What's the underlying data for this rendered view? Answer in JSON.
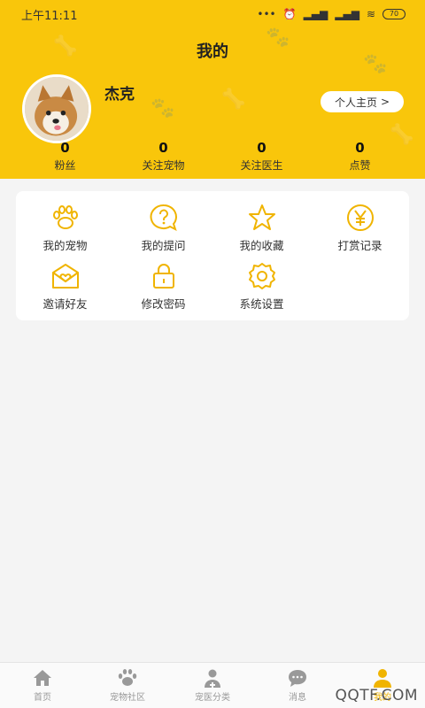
{
  "status": {
    "time": "上午11:11",
    "battery": "70"
  },
  "header": {
    "title": "我的"
  },
  "profile": {
    "name": "杰克",
    "homepage_label": "个人主页"
  },
  "stats": [
    {
      "value": "0",
      "label": "粉丝"
    },
    {
      "value": "0",
      "label": "关注宠物"
    },
    {
      "value": "0",
      "label": "关注医生"
    },
    {
      "value": "0",
      "label": "点赞"
    }
  ],
  "menu": [
    {
      "label": "我的宠物",
      "icon": "paw-icon"
    },
    {
      "label": "我的提问",
      "icon": "question-bubble-icon"
    },
    {
      "label": "我的收藏",
      "icon": "star-icon"
    },
    {
      "label": "打赏记录",
      "icon": "yen-coin-icon"
    },
    {
      "label": "邀请好友",
      "icon": "envelope-heart-icon"
    },
    {
      "label": "修改密码",
      "icon": "lock-icon"
    },
    {
      "label": "系统设置",
      "icon": "gear-icon"
    }
  ],
  "tabs": [
    {
      "label": "首页",
      "icon": "home-icon"
    },
    {
      "label": "宠物社区",
      "icon": "paw-icon"
    },
    {
      "label": "宠医分类",
      "icon": "doctor-icon"
    },
    {
      "label": "消息",
      "icon": "chat-bubble-icon"
    },
    {
      "label": "我的",
      "icon": "user-icon"
    }
  ],
  "colors": {
    "accent": "#f9c60b",
    "tab_inactive": "#999999",
    "tab_active": "#f0b400"
  },
  "watermark": "QQTF.COM"
}
